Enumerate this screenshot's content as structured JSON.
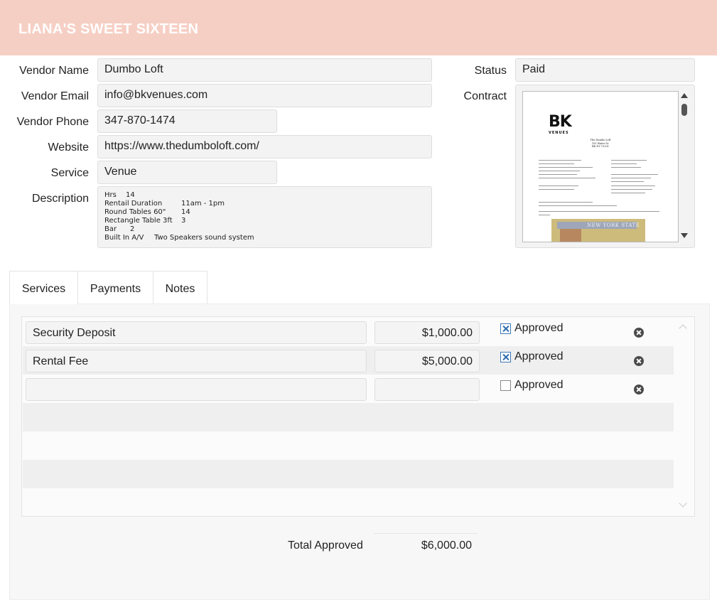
{
  "header": {
    "title": "LIANA'S SWEET SIXTEEN"
  },
  "fields": {
    "vendor_name": {
      "label": "Vendor Name",
      "value": "Dumbo Loft"
    },
    "vendor_email": {
      "label": "Vendor Email",
      "value": "info@bkvenues.com"
    },
    "vendor_phone": {
      "label": "Vendor Phone",
      "value": "347-870-1474"
    },
    "website": {
      "label": "Website",
      "value": "https://www.thedumboloft.com/"
    },
    "service": {
      "label": "Service",
      "value": "Venue"
    },
    "description": {
      "label": "Description",
      "lines": [
        {
          "key": "Hrs",
          "value": "14"
        },
        {
          "key": "Rentail Duration",
          "value": "11am - 1pm"
        },
        {
          "key": "Round Tables 60\"",
          "value": "14"
        },
        {
          "key": "Rectangle Table 3ft",
          "value": "3"
        },
        {
          "key": "Bar",
          "value": "2"
        },
        {
          "key": "Built In A/V",
          "value": "Two Speakers sound system"
        }
      ]
    },
    "status": {
      "label": "Status",
      "value": "Paid"
    },
    "contract": {
      "label": "Contract",
      "logo_text": "BK",
      "logo_sub": "VENUES",
      "address_lines": [
        "The Dumbo Loft",
        "155 Water St.",
        "BK NY 11201"
      ],
      "photo_caption": "NEW YORK STATE"
    }
  },
  "tabs": [
    {
      "label": "Services",
      "active": true
    },
    {
      "label": "Payments",
      "active": false
    },
    {
      "label": "Notes",
      "active": false
    }
  ],
  "services": {
    "approved_label": "Approved",
    "rows": [
      {
        "name": "Security Deposit",
        "amount": "$1,000.00",
        "approved": true
      },
      {
        "name": "Rental Fee",
        "amount": "$5,000.00",
        "approved": true
      },
      {
        "name": "",
        "amount": "",
        "approved": false
      }
    ]
  },
  "totals": {
    "label": "Total Approved",
    "value": "$6,000.00"
  },
  "colors": {
    "header_bg": "#f6cfc4",
    "checkbox_accent": "#2f6db0"
  }
}
